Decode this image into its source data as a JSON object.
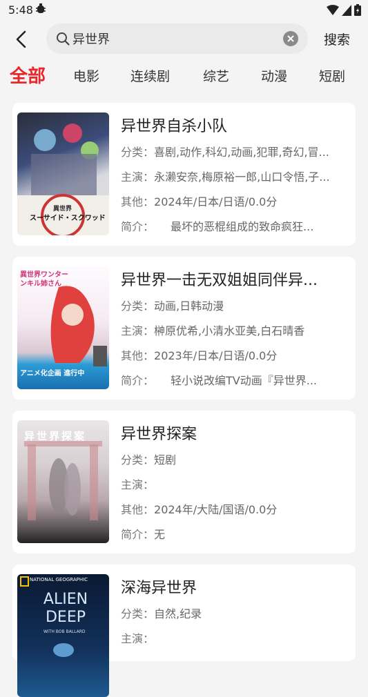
{
  "status": {
    "time": "5:48"
  },
  "search": {
    "value": "异世界",
    "button_label": "搜索"
  },
  "tabs": [
    "全部",
    "电影",
    "连续剧",
    "综艺",
    "动漫",
    "短剧"
  ],
  "labels": {
    "category": "分类：",
    "cast": "主演：",
    "other": "其他：",
    "summary": "简介："
  },
  "results": [
    {
      "title": "异世界自杀小队",
      "category": "喜剧,动作,科幻,动画,犯罪,奇幻,冒...",
      "cast": "永濑安奈,梅原裕一郎,山口令悟,子...",
      "other": "2024年/日本/日语/0.0分",
      "summary": "　　最坏的恶棍组成的致命疯狂..."
    },
    {
      "title": "异世界一击无双姐姐同伴异...",
      "category": "动画,日韩动漫",
      "cast": "榊原优希,小清水亚美,白石晴香",
      "other": "2023年/日本/日语/0.0分",
      "summary": "　　轻小说改编TV动画『异世界..."
    },
    {
      "title": "异世界探案",
      "category": "短剧",
      "cast": "",
      "other": "2024年/大陆/国语/0.0分",
      "summary": "无"
    },
    {
      "title": "深海异世界",
      "category": "自然,纪录",
      "cast": "",
      "other": "",
      "summary": ""
    }
  ],
  "posters": [
    {
      "text_top": "異世界",
      "text_main": "スーサイド・スクワッド"
    },
    {
      "text_top": "異世界ワンターンキル姉さん",
      "text_main": "アニメ化企画 進行中"
    },
    {
      "text_top": "异世界探案"
    },
    {
      "text_top": "NATIONAL GEOGRAPHIC",
      "text_main": "ALIEN DEEP",
      "text_sub": "WITH BOB BALLARD"
    }
  ],
  "colors": {
    "accent": "#e8262c",
    "background": "#f4f4f4",
    "card": "#ffffff"
  }
}
